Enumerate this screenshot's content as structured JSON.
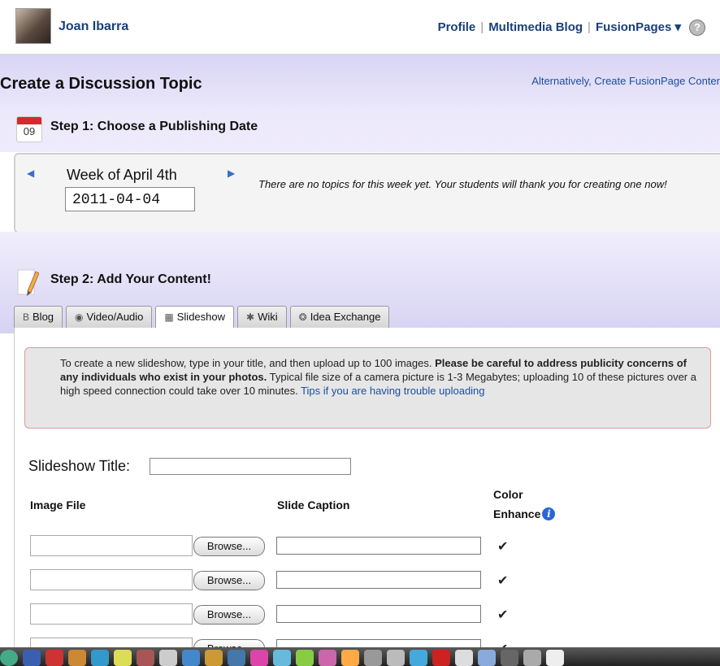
{
  "header": {
    "username": "Joan Ibarra",
    "nav": [
      "Profile",
      "Multimedia Blog",
      "FusionPages ▾"
    ],
    "help_glyph": "?"
  },
  "page": {
    "title": "Create a Discussion Topic",
    "alt_link": "Alternatively, Create FusionPage Conter"
  },
  "step1": {
    "calendar_day": "09",
    "label": "Step 1: Choose a Publishing Date",
    "week_label": "Week of April 4th",
    "date_value": "2011-04-04",
    "prev_arrow": "◀",
    "next_arrow": "▶",
    "no_topics": "There are no topics for this week yet. Your students will thank you for creating one now!"
  },
  "step2": {
    "label": "Step 2: Add Your Content!",
    "tabs": [
      {
        "icon": "B",
        "label": "Blog"
      },
      {
        "icon": "◉",
        "label": "Video/Audio"
      },
      {
        "icon": "▦",
        "label": "Slideshow"
      },
      {
        "icon": "✱",
        "label": "Wiki"
      },
      {
        "icon": "❂",
        "label": "Idea Exchange"
      }
    ],
    "active_tab": "Slideshow"
  },
  "notice": {
    "part1": "To create a new slideshow, type in your title, and then upload up to 100 images. ",
    "bold": "Please be careful to address publicity concerns of any individuals who exist in your photos.",
    "part2": " Typical file size of a camera picture is 1-3 Megabytes; uploading 10 of these pictures over a high speed connection could take over 10 minutes. ",
    "link": "Tips if you are having trouble uploading"
  },
  "form": {
    "title_label": "Slideshow Title:",
    "col_image": "Image File",
    "col_caption": "Slide Caption",
    "col_color_1": "Color",
    "col_color_2": "Enhance",
    "info_glyph": "i",
    "browse_label": "Browse...",
    "checkmark": "✔",
    "rows": [
      {
        "color_enhance": true
      },
      {
        "color_enhance": true
      },
      {
        "color_enhance": true
      },
      {
        "color_enhance": true
      }
    ]
  },
  "dock": {
    "colors": [
      "#4a8",
      "#3a5fb0",
      "#c33",
      "#c83",
      "#39c",
      "#dd5",
      "#a55",
      "#ccc",
      "#48c",
      "#c93",
      "#47a",
      "#d4a",
      "#6bd",
      "#8c4",
      "#c6a",
      "#fa4",
      "#999",
      "#bbb",
      "#4ad",
      "#c22",
      "#ddd",
      "#8ad",
      "#666",
      "#aaa",
      "#eee"
    ]
  }
}
